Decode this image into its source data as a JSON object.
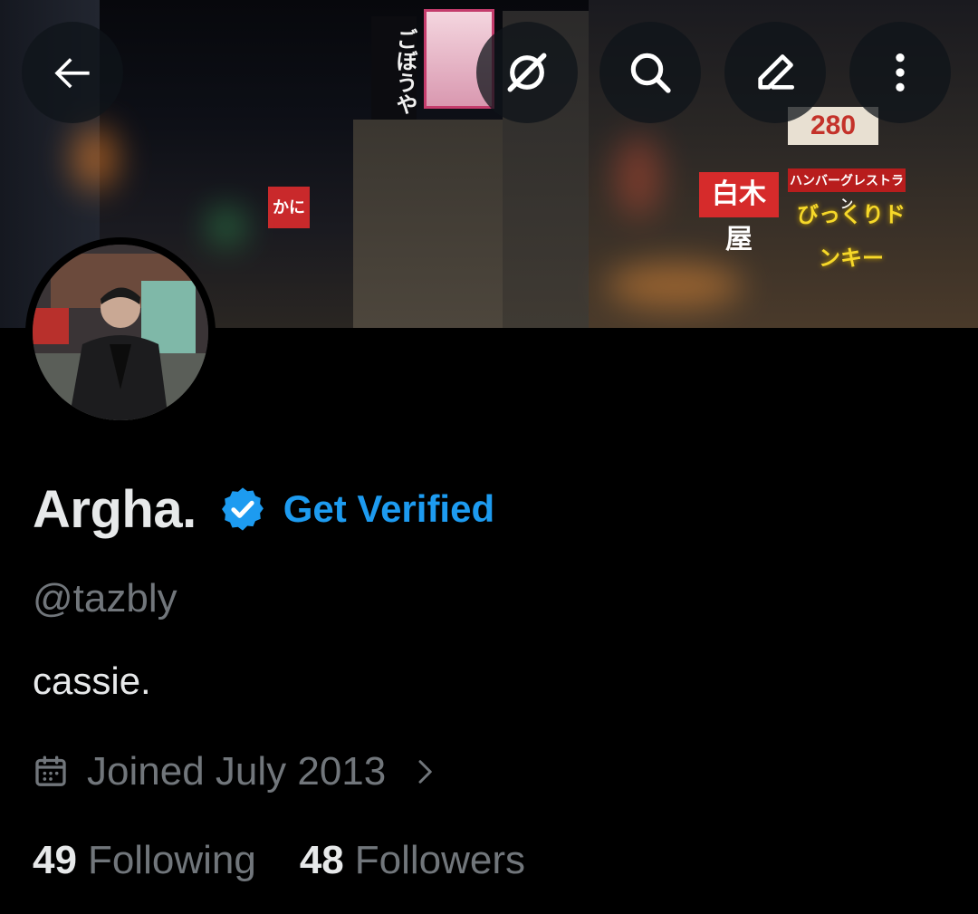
{
  "profile": {
    "display_name": "Argha.",
    "get_verified_label": "Get Verified",
    "handle": "@tazbly",
    "bio": "cassie.",
    "joined": "Joined July 2013",
    "following_count": "49",
    "following_label": "Following",
    "followers_count": "48",
    "followers_label": "Followers"
  },
  "toolbar": {
    "back_icon": "arrow-left-icon",
    "grok_icon": "grok-icon",
    "search_icon": "search-icon",
    "edit_icon": "pencil-icon",
    "more_icon": "more-vertical-icon"
  },
  "banner_signs": {
    "sign_1": "白木屋",
    "sign_2": "びっくりドンキー",
    "sign_3": "ハンバーグレストラン",
    "sign_4": "280",
    "sign_5": "ごぼうや",
    "sign_6": "かに"
  },
  "colors": {
    "background": "#000000",
    "primary_text": "#e7e9ea",
    "secondary_text": "#71767b",
    "accent": "#1d9bf0"
  }
}
